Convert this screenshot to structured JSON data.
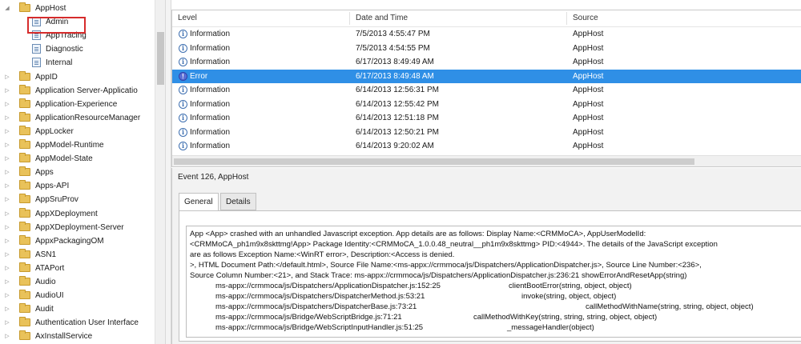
{
  "tree": {
    "items": [
      {
        "label": "AppHost",
        "type": "folder",
        "expanded": true,
        "level": 0
      },
      {
        "label": "Admin",
        "type": "log",
        "level": 1,
        "selected": true
      },
      {
        "label": "AppTracing",
        "type": "log",
        "level": 1
      },
      {
        "label": "Diagnostic",
        "type": "log",
        "level": 1
      },
      {
        "label": "Internal",
        "type": "log",
        "level": 1
      },
      {
        "label": "AppID",
        "type": "folder",
        "level": 0
      },
      {
        "label": "Application Server-Applicatio",
        "type": "folder",
        "level": 0
      },
      {
        "label": "Application-Experience",
        "type": "folder",
        "level": 0
      },
      {
        "label": "ApplicationResourceManager",
        "type": "folder",
        "level": 0
      },
      {
        "label": "AppLocker",
        "type": "folder",
        "level": 0
      },
      {
        "label": "AppModel-Runtime",
        "type": "folder",
        "level": 0
      },
      {
        "label": "AppModel-State",
        "type": "folder",
        "level": 0
      },
      {
        "label": "Apps",
        "type": "folder",
        "level": 0
      },
      {
        "label": "Apps-API",
        "type": "folder",
        "level": 0
      },
      {
        "label": "AppSruProv",
        "type": "folder",
        "level": 0
      },
      {
        "label": "AppXDeployment",
        "type": "folder",
        "level": 0
      },
      {
        "label": "AppXDeployment-Server",
        "type": "folder",
        "level": 0
      },
      {
        "label": "AppxPackagingOM",
        "type": "folder",
        "level": 0
      },
      {
        "label": "ASN1",
        "type": "folder",
        "level": 0
      },
      {
        "label": "ATAPort",
        "type": "folder",
        "level": 0
      },
      {
        "label": "Audio",
        "type": "folder",
        "level": 0
      },
      {
        "label": "AudioUI",
        "type": "folder",
        "level": 0
      },
      {
        "label": "Audit",
        "type": "folder",
        "level": 0
      },
      {
        "label": "Authentication User Interface",
        "type": "folder",
        "level": 0
      },
      {
        "label": "AxInstallService",
        "type": "folder",
        "level": 0
      }
    ]
  },
  "events": {
    "columns": [
      "Level",
      "Date and Time",
      "Source"
    ],
    "rows": [
      {
        "level": "Information",
        "date": "7/5/2013 4:55:47 PM",
        "source": "AppHost",
        "icon": "info"
      },
      {
        "level": "Information",
        "date": "7/5/2013 4:54:55 PM",
        "source": "AppHost",
        "icon": "info"
      },
      {
        "level": "Information",
        "date": "6/17/2013 8:49:49 AM",
        "source": "AppHost",
        "icon": "info"
      },
      {
        "level": "Error",
        "date": "6/17/2013 8:49:48 AM",
        "source": "AppHost",
        "icon": "error",
        "selected": true
      },
      {
        "level": "Information",
        "date": "6/14/2013 12:56:31 PM",
        "source": "AppHost",
        "icon": "info"
      },
      {
        "level": "Information",
        "date": "6/14/2013 12:55:42 PM",
        "source": "AppHost",
        "icon": "info"
      },
      {
        "level": "Information",
        "date": "6/14/2013 12:51:18 PM",
        "source": "AppHost",
        "icon": "info"
      },
      {
        "level": "Information",
        "date": "6/14/2013 12:50:21 PM",
        "source": "AppHost",
        "icon": "info"
      },
      {
        "level": "Information",
        "date": "6/14/2013 9:20:02 AM",
        "source": "AppHost",
        "icon": "info"
      }
    ]
  },
  "details": {
    "title": "Event 126, AppHost",
    "tabs": [
      "General",
      "Details"
    ],
    "active_tab": "General",
    "message_lines": [
      "App <App> crashed with an unhandled Javascript exception. App details are as follows: Display Name:<CRMMoCA>, AppUserModelId:",
      "<CRMMoCA_ph1m9x8skttmg!App> Package Identity:<CRMMoCA_1.0.0.48_neutral__ph1m9x8skttmg> PID:<4944>. The details of the JavaScript exception",
      "are as follows Exception Name:<WinRT error>, Description:<Access is denied.",
      ">, HTML Document Path:</default.html>, Source File Name:<ms-appx://crmmoca/js/Dispatchers/ApplicationDispatcher.js>, Source Line Number:<236>,",
      "Source Column Number:<21>, and Stack Trace: ms-appx://crmmoca/js/Dispatchers/ApplicationDispatcher.js:236:21        showErrorAndResetApp(string)"
    ],
    "stack": [
      {
        "path": "ms-appx://crmmoca/js/Dispatchers/ApplicationDispatcher.js:152:25",
        "fn": "clientBootError(string, object, object)"
      },
      {
        "path": "ms-appx://crmmoca/js/Dispatchers/DispatcherMethod.js:53:21",
        "fn": "invoke(string, object, object)"
      },
      {
        "path": "ms-appx://crmmoca/js/Dispatchers/DispatcherBase.js:73:21",
        "fn": "callMethodWithName(string, string, object, object)"
      },
      {
        "path": "ms-appx://crmmoca/js/Bridge/WebScriptBridge.js:71:21",
        "fn": "callMethodWithKey(string, string, string, object, object)"
      },
      {
        "path": "ms-appx://crmmoca/js/Bridge/WebScriptInputHandler.js:51:25",
        "fn": "_messageHandler(object)"
      }
    ]
  },
  "colors": {
    "selection": "#2f8fe6",
    "highlight_box": "#d62c2c",
    "folder": "#e9c25a"
  }
}
